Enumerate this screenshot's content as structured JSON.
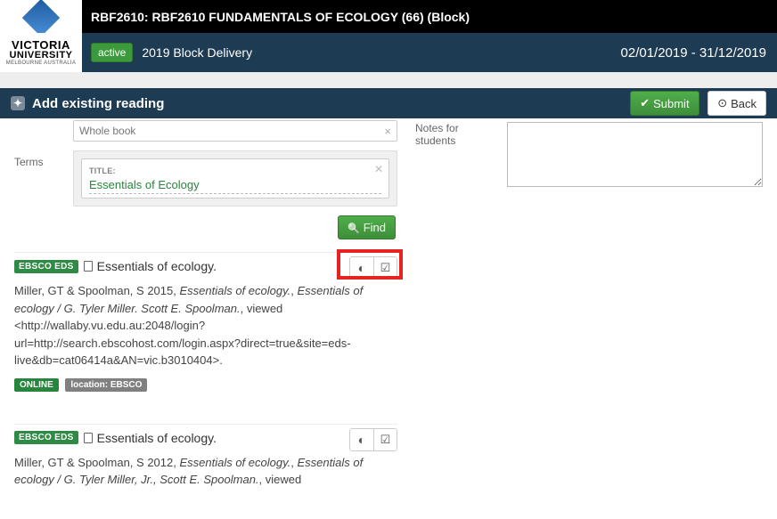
{
  "logo": {
    "line1": "VICTORIA",
    "line2": "UNIVERSITY",
    "line3": "MELBOURNE AUSTRALIA"
  },
  "title": "RBF2610: RBF2610 FUNDAMENTALS OF ECOLOGY (66) (Block)",
  "status": "active",
  "delivery": "2019 Block Delivery",
  "date_range": "02/01/2019 - 31/12/2019",
  "toolbar": {
    "heading": "Add existing reading",
    "submit": "Submit",
    "back": "Back"
  },
  "form": {
    "doc_label": "",
    "doc_value": "Whole book",
    "terms_label": "Terms",
    "term_title_label": "TITLE:",
    "term_title_value": "Essentials of Ecology",
    "find": "Find",
    "notes_label": "Notes for students"
  },
  "results": [
    {
      "source": "EBSCO EDS",
      "title": "Essentials of ecology.",
      "citation_parts": {
        "authors_year": "Miller, GT & Spoolman, S 2015, ",
        "ital1": "Essentials of ecology.",
        "mid": ", ",
        "ital2": "Essentials of ecology / G. Tyler Miller. Scott E. Spoolman.",
        "viewed": ", viewed <http://wallaby.vu.edu.au:2048/login?url=http://search.ebscohost.com/login.aspx?direct=true&site=eds-live&db=cat06414a&AN=vic.b3010404>."
      },
      "online": "ONLINE",
      "location": "location: EBSCO",
      "highlighted": true
    },
    {
      "source": "EBSCO EDS",
      "title": "Essentials of ecology.",
      "citation_parts": {
        "authors_year": "Miller, GT & Spoolman, S 2012, ",
        "ital1": "Essentials of ecology.",
        "mid": ", ",
        "ital2": "Essentials of ecology / G. Tyler Miller, Jr., Scott E. Spoolman.",
        "viewed": ", viewed"
      },
      "online": "",
      "location": "",
      "highlighted": false
    }
  ]
}
